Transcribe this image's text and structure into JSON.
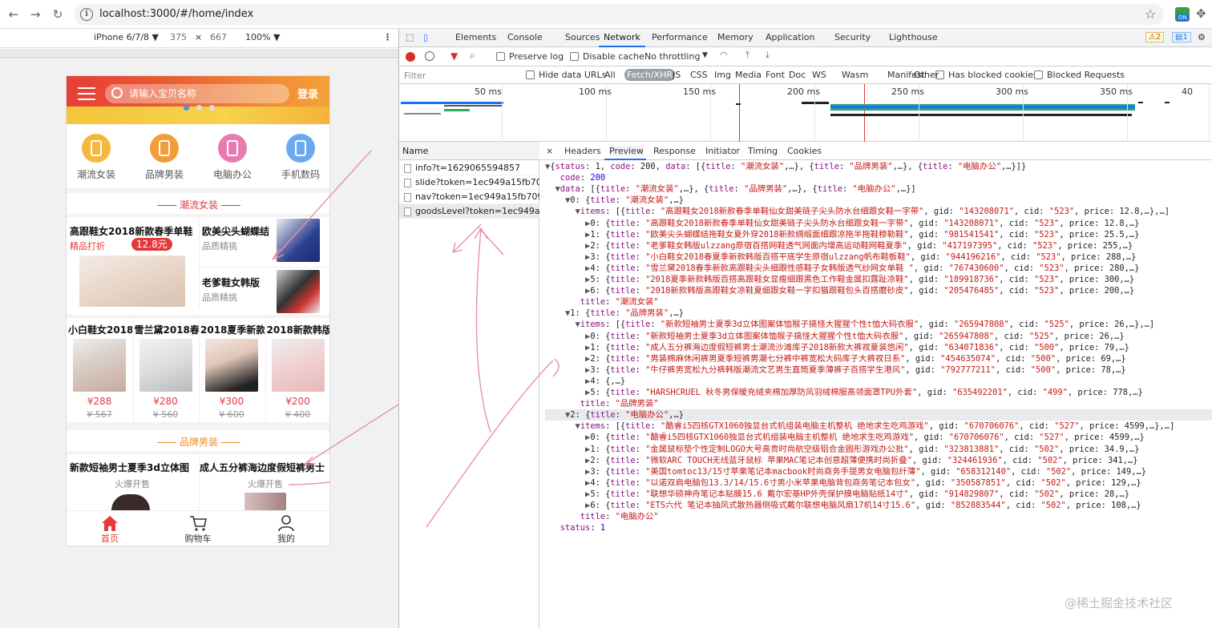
{
  "browser": {
    "url": "localhost:3000/#/home/index"
  },
  "device_toolbar": {
    "device": "iPhone 6/7/8 ▼",
    "width": "375",
    "times": "×",
    "height": "667",
    "zoom": "100% ▼"
  },
  "phone": {
    "search_placeholder": "请输入宝贝名称",
    "login": "登录",
    "categories": [
      {
        "label": "潮流女装",
        "color": "#f6b73c",
        "icon": "dress-icon"
      },
      {
        "label": "品牌男装",
        "color": "#f39c3a",
        "icon": "jacket-icon"
      },
      {
        "label": "电脑办公",
        "color": "#e97bb1",
        "icon": "computer-icon"
      },
      {
        "label": "手机数码",
        "color": "#6aa9f0",
        "icon": "phone-icon"
      }
    ],
    "section1": {
      "title": "潮流女装",
      "big": {
        "title": "高跟鞋女2018新款春季单鞋",
        "tag": "精品打折",
        "price": "12.8元"
      },
      "right": [
        {
          "title": "欧美尖头蝴蝶结",
          "sub": "品质精挑"
        },
        {
          "title": "老爹鞋女韩版",
          "sub": "品质精挑"
        }
      ],
      "row": [
        {
          "title": "小白鞋女2018",
          "price": "¥288",
          "old": "¥ 567"
        },
        {
          "title": "雪兰黛2018春",
          "price": "¥280",
          "old": "¥ 560"
        },
        {
          "title": "2018夏季新款",
          "price": "¥300",
          "old": "¥ 600"
        },
        {
          "title": "2018新款韩版",
          "price": "¥200",
          "old": "¥ 400"
        }
      ]
    },
    "section2": {
      "title": "品牌男装",
      "items": [
        {
          "title": "新款短袖男士夏季3d立体图",
          "sub": "火爆开售"
        },
        {
          "title": "成人五分裤海边度假短裤男士",
          "sub": "火爆开售"
        }
      ]
    },
    "tabbar": [
      {
        "label": "首页",
        "active": true
      },
      {
        "label": "购物车",
        "active": false
      },
      {
        "label": "我的",
        "active": false
      }
    ]
  },
  "devtools": {
    "tabs": [
      "Elements",
      "Console",
      "Sources",
      "Network",
      "Performance",
      "Memory",
      "Application",
      "Security",
      "Lighthouse"
    ],
    "active_tab": "Network",
    "warnings": "2",
    "messages": "1",
    "toolbar": {
      "preserve_log": "Preserve log",
      "disable_cache": "Disable cache",
      "throttling": "No throttling"
    },
    "filter": {
      "placeholder": "Filter",
      "hide_data_urls": "Hide data URLs",
      "types": [
        "All",
        "Fetch/XHR",
        "JS",
        "CSS",
        "Img",
        "Media",
        "Font",
        "Doc",
        "WS",
        "Wasm",
        "Manifest",
        "Other"
      ],
      "active_type": "Fetch/XHR",
      "has_blocked": "Has blocked cookies",
      "blocked_requests": "Blocked Requests"
    },
    "timeline_ticks": [
      "50 ms",
      "100 ms",
      "150 ms",
      "200 ms",
      "250 ms",
      "300 ms",
      "350 ms",
      "40"
    ],
    "name_header": "Name",
    "requests": [
      "info?t=1629065594857",
      "slide?token=1ec949a15fb70...",
      "nav?token=1ec949a15fb709...",
      "goodsLevel?token=1ec949a..."
    ],
    "detail_tabs": [
      "×",
      "Headers",
      "Preview",
      "Response",
      "Initiator",
      "Timing",
      "Cookies"
    ],
    "active_detail_tab": "Preview",
    "json_lines": [
      "▼{status: 1, code: 200, data: [{title: \"潮流女装\",…}, {title: \"品牌男装\",…}, {title: \"电脑办公\",…}]}",
      "   code: 200",
      "  ▼data: [{title: \"潮流女装\",…}, {title: \"品牌男装\",…}, {title: \"电脑办公\",…}]",
      "    ▼0: {title: \"潮流女装\",…}",
      "      ▼items: [{title: \"高跟鞋女2018新款春季单鞋仙女甜美链子尖头防水台细跟女鞋一字带\", gid: \"143208071\", cid: \"523\", price: 12.8,…},…]",
      "        ▶0: {title: \"高跟鞋女2018新款春季单鞋仙女甜美链子尖头防水台细跟女鞋一字带\", gid: \"143208071\", cid: \"523\", price: 12.8,…}",
      "        ▶1: {title: \"欧美尖头蝴蝶结拖鞋女夏外穿2018新款绸缎面细跟凉拖半拖鞋穆勒鞋\", gid: \"981541541\", cid: \"523\", price: 25.5,…}",
      "        ▶2: {title: \"老爹鞋女韩版ulzzang原宿百搭网鞋透气网面内增高运动鞋网鞋夏季\", gid: \"417197395\", cid: \"523\", price: 255,…}",
      "        ▶3: {title: \"小白鞋女2018春夏季新款韩版百搭平底学生原宿ulzzang帆布鞋板鞋\", gid: \"944196216\", cid: \"523\", price: 288,…}",
      "        ▶4: {title: \"雪兰黛2018春季新款高跟鞋尖头细跟性感鞋子女韩版透气纱网女单鞋 \", gid: \"767430600\", cid: \"523\", price: 280,…}",
      "        ▶5: {title: \"2018夏季新款韩版百搭高跟鞋女显瘦细跟黑色工作鞋金属扣露趾凉鞋\", gid: \"189918736\", cid: \"523\", price: 300,…}",
      "        ▶6: {title: \"2018新款韩版高跟鞋女凉鞋夏细跟女鞋一字扣猫跟鞋包头百搭磨砂皮\", gid: \"205476485\", cid: \"523\", price: 200,…}",
      "       title: \"潮流女装\"",
      "    ▼1: {title: \"品牌男装\",…}",
      "      ▼items: [{title: \"新款短袖男士夏季3d立体图案体恤猴子搞怪大猩猩个性t恤大码衣服\", gid: \"265947808\", cid: \"525\", price: 26,…},…]",
      "        ▶0: {title: \"新款短袖男士夏季3d立体图案体恤猴子搞怪大猩猩个性t恤大码衣服\", gid: \"265947808\", cid: \"525\", price: 26,…}",
      "        ▶1: {title: \"成人五分裤海边度假短裤男士潮流沙滩库子2018新款大裤衩夏装悠闲\", gid: \"634071836\", cid: \"500\", price: 79,…}",
      "        ▶2: {title: \"男装棉麻休闲裤男夏季短裤男潮七分裤中裤宽松大码库子大裤衩日系\", gid: \"454635074\", cid: \"500\", price: 69,…}",
      "        ▶3: {title: \"牛仔裤男宽松九分裤韩版潮流文艺男生直筒夏季薄裤子百搭学生港风\", gid: \"792777211\", cid: \"500\", price: 78,…}",
      "        ▶4: {,…}",
      "        ▶5: {title: \"HARSHCRUEL 秋冬男保暖充绒夹棉加厚防风羽绒棉服高领面罩TPU外套\", gid: \"635492201\", cid: \"499\", price: 778,…}",
      "       title: \"品牌男装\"",
      "    ▼2: {title: \"电脑办公\",…}",
      "      ▼items: [{title: \"酷睿i5四核GTX1060独显台式机组装电脑主机整机 绝地求生吃鸡游戏\", gid: \"670706076\", cid: \"527\", price: 4599,…},…]",
      "        ▶0: {title: \"酷睿i5四核GTX1060独显台式机组装电脑主机整机 绝地求生吃鸡游戏\", gid: \"670706076\", cid: \"527\", price: 4599,…}",
      "        ▶1: {title: \"金属鼠标垫个性定制LOGO大号高贵时尚航空级铝合金圆形游戏办公批\", gid: \"323813881\", cid: \"502\", price: 34.9,…}",
      "        ▶2: {title: \"微软ARC TOUCH无线蓝牙鼠标 苹果MAC笔记本创意超薄便携时尚折叠\", gid: \"324461936\", cid: \"502\", price: 341,…}",
      "        ▶3: {title: \"美国tomtoc13/15寸苹果笔记本macbook时尚商务手提男女电脑包纤薄\", gid: \"658312140\", cid: \"502\", price: 149,…}",
      "        ▶4: {title: \"以诺双肩电脑包13.3/14/15.6寸男小米苹果电脑背包商务笔记本包女\", gid: \"350587851\", cid: \"502\", price: 129,…}",
      "        ▶5: {title: \"联想华硕神舟笔记本贴膜15.6 戴尔宏基HP外壳保护膜电脑贴纸14寸\", gid: \"914829807\", cid: \"502\", price: 28,…}",
      "        ▶6: {title: \"ETS六代 笔记本抽风式散热器侧吸式戴尔联想电脑风扇17机14寸15.6\", gid: \"852883544\", cid: \"502\", price: 108,…}",
      "       title: \"电脑办公\"",
      "   status: 1"
    ]
  },
  "watermark": "@稀土掘金技术社区"
}
